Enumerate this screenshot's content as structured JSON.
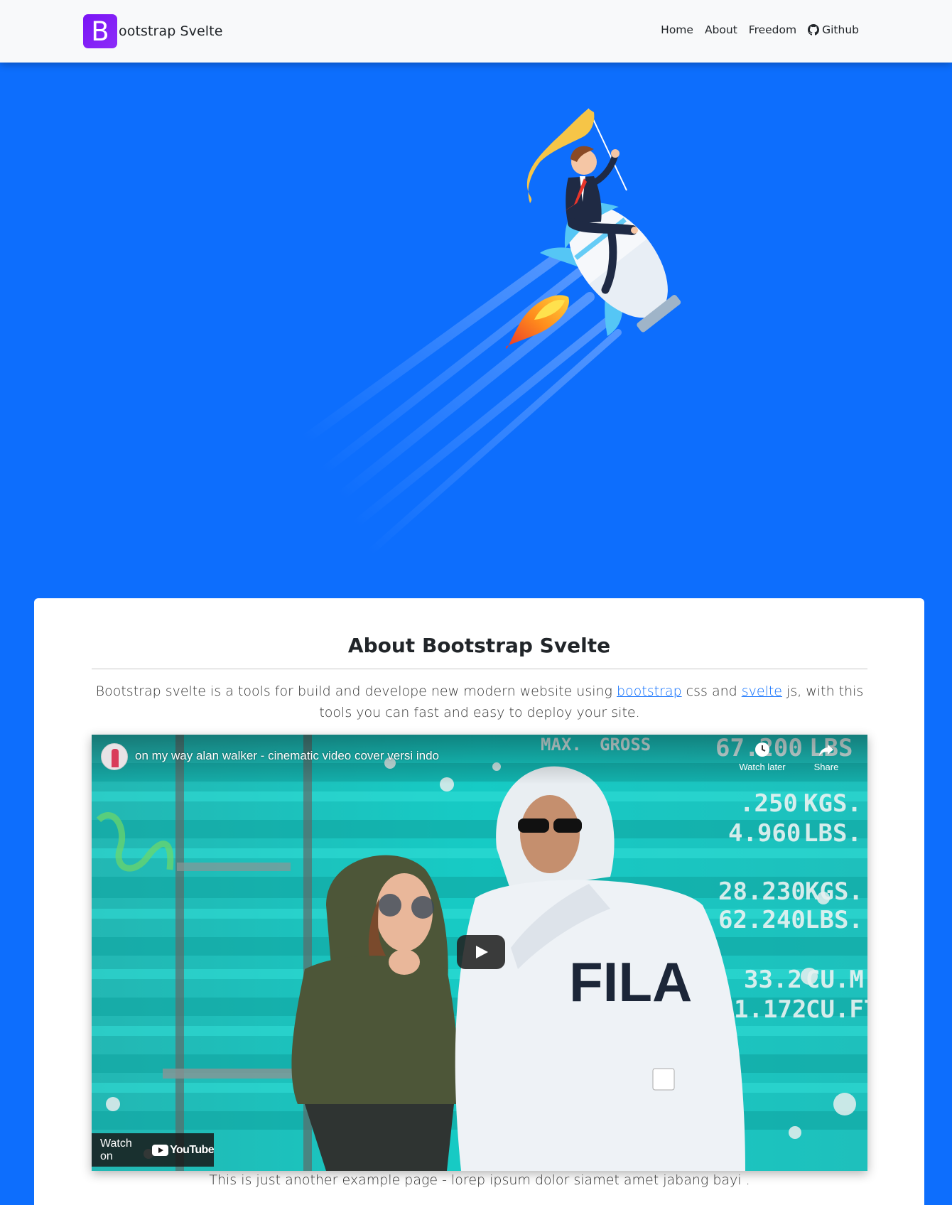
{
  "navbar": {
    "brand_letter": "B",
    "brand_text": "ootstrap Svelte",
    "links": [
      {
        "label": "Home"
      },
      {
        "label": "About"
      },
      {
        "label": "Freedom"
      },
      {
        "label": "Github",
        "icon": "github-icon"
      }
    ]
  },
  "hero": {
    "background": "#0d6efd",
    "illustration": "businessman-riding-rocket-with-flag"
  },
  "about": {
    "title": "About Bootstrap Svelte",
    "desc_before": "Bootstrap svelte is a tools for build and develope new modern website using ",
    "link_bootstrap": "bootstrap",
    "desc_middle": " css and ",
    "link_svelte": "svelte",
    "desc_after": " js, with this tools you can fast and easy to deploy your site.",
    "footer_text": "This is just another example page - lorep ipsum dolor siamet amet jabang bayi ."
  },
  "video": {
    "title": "on my way alan walker - cinematic video cover versi indo",
    "watch_later": "Watch later",
    "share": "Share",
    "watch_on": "Watch on",
    "youtube": "YouTube",
    "container_text": [
      "MAX.",
      "GROSS",
      "67.200",
      "LBS",
      ".250",
      "KGS.",
      "4.960",
      "LBS.",
      "28.230",
      "KGS.",
      "62.240",
      "LBS.",
      "33.2",
      "CU.M.",
      "1.172",
      "CU.FT"
    ],
    "hoodie_text": "FILA"
  },
  "colors": {
    "primary": "#0d6efd",
    "brand_purple": "#7a14f5",
    "navbar_bg": "#f8f9fa",
    "container_teal": "#15c4c0"
  }
}
